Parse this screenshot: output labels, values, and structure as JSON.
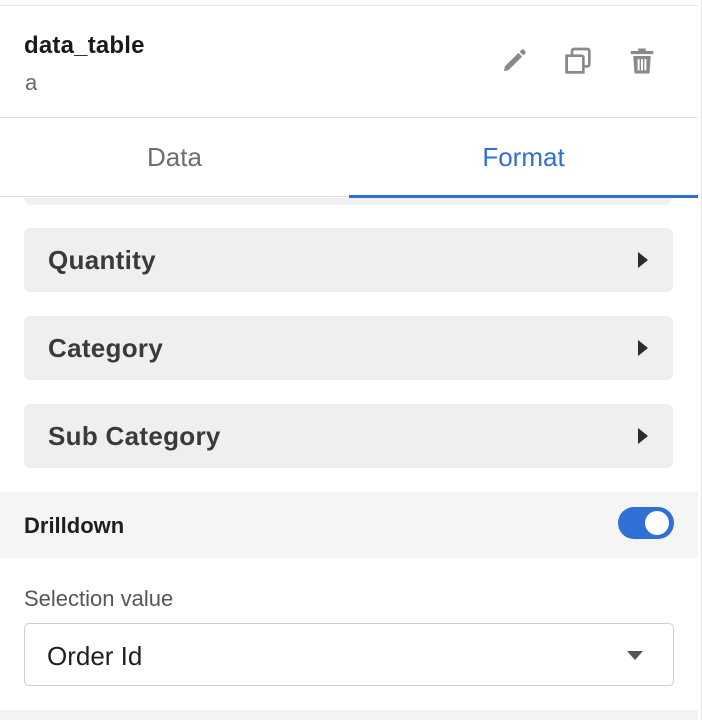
{
  "header": {
    "title": "data_table",
    "subtitle": "a",
    "icons": [
      "edit-icon",
      "copy-icon",
      "delete-icon"
    ]
  },
  "tabs": [
    {
      "label": "Data",
      "active": false
    },
    {
      "label": "Format",
      "active": true
    }
  ],
  "sections": [
    {
      "label": "Quantity"
    },
    {
      "label": "Category"
    },
    {
      "label": "Sub Category"
    }
  ],
  "drilldown": {
    "label": "Drilldown",
    "enabled": true
  },
  "selection": {
    "label": "Selection value",
    "value": "Order Id"
  },
  "colors": {
    "accent": "#2f6fd6",
    "icon": "#8a8a8a",
    "card_bg": "#efefef"
  }
}
